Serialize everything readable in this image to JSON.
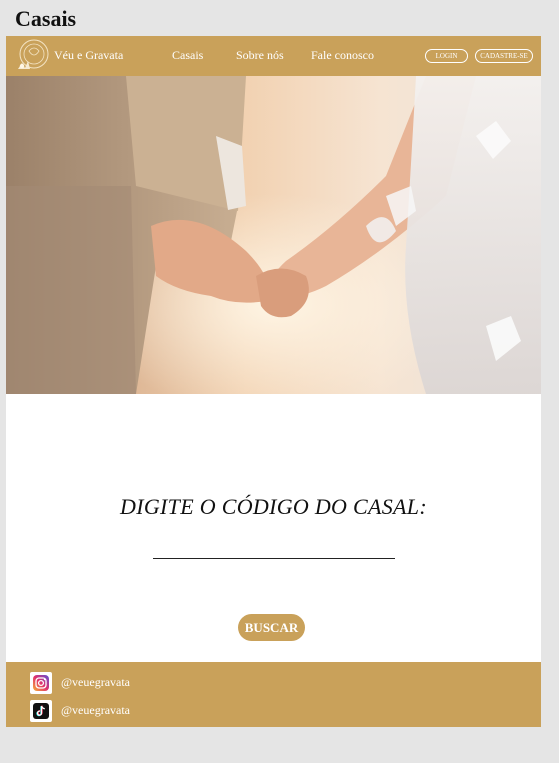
{
  "page": {
    "title": "Casais"
  },
  "navbar": {
    "brand": "Véu e Gravata",
    "links": [
      "Casais",
      "Sobre nós",
      "Fale conosco"
    ],
    "login_label": "LOGIN",
    "signup_label": "CADASTRE-SE"
  },
  "search": {
    "label": "DIGITE O CÓDIGO DO CASAL:",
    "input_value": "",
    "button_label": "BUSCAR"
  },
  "footer": {
    "instagram_handle": "@veuegravata",
    "tiktok_handle": "@veuegravata"
  },
  "colors": {
    "accent": "#c9a15a",
    "background": "#e5e5e5",
    "content": "#ffffff"
  }
}
